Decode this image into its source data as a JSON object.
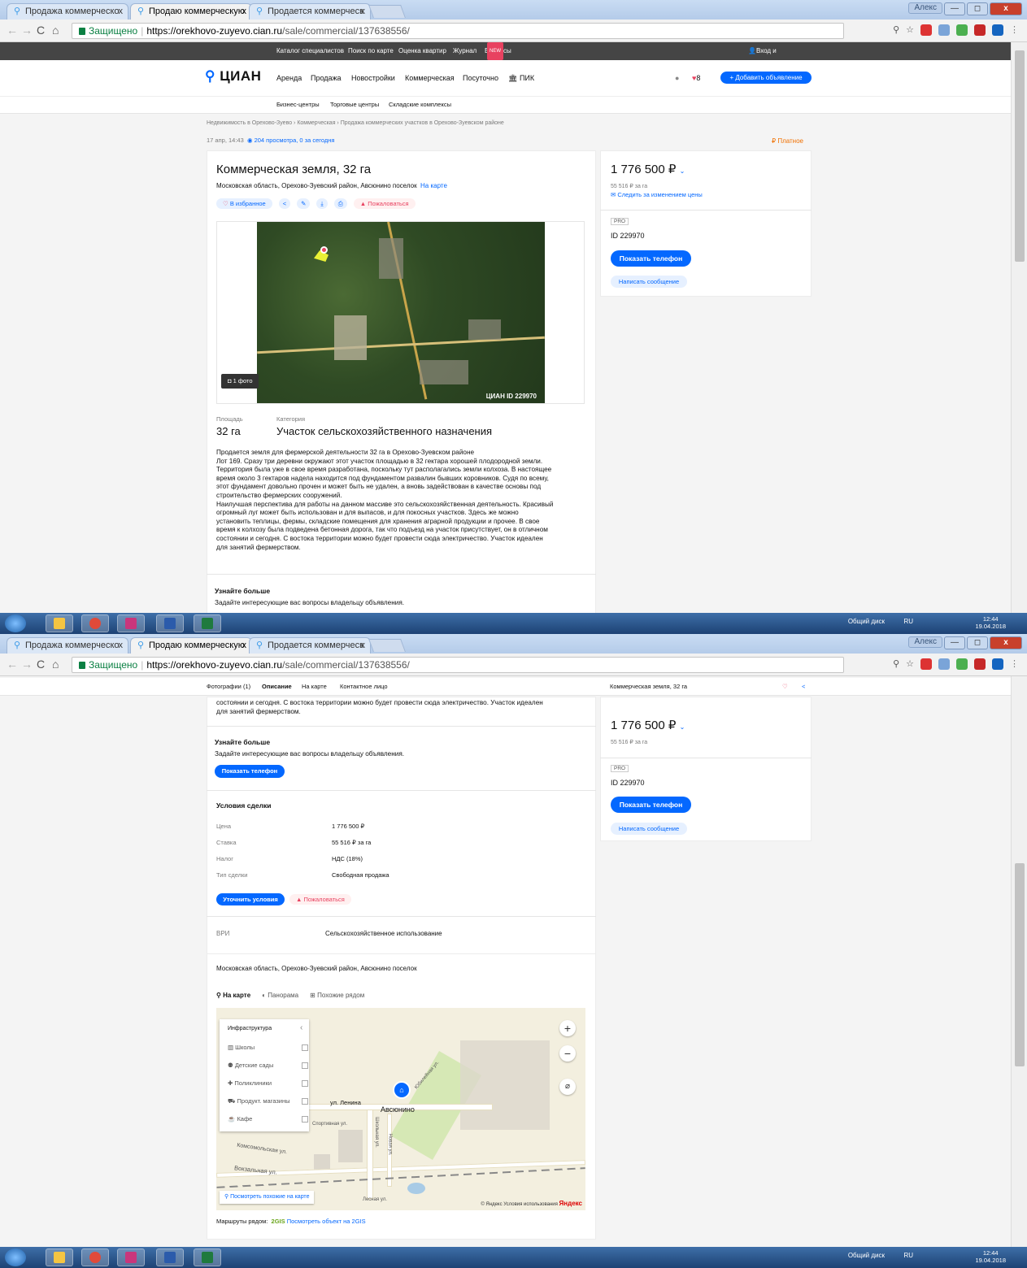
{
  "browser": {
    "tabs": [
      "Продажа коммерческо",
      "Продаю коммерческую",
      "Продается коммерческ"
    ],
    "tab_close": "x",
    "window_user": "Алекс",
    "window_buttons": [
      "—",
      "◻",
      "x"
    ],
    "nav_icons": [
      "←",
      "→",
      "C",
      "⌂"
    ],
    "secure_label": "Защищено",
    "url_host": "https://orekhovo-zuyevo.cian.ru",
    "url_path": "/sale/commercial/137638556/"
  },
  "topbar": {
    "links": [
      "Каталог специалистов",
      "Поиск по карте",
      "Оценка квартир",
      "Журнал",
      "Вопросы риэлтору"
    ],
    "new_badge": "NEW",
    "login": "Вход и регистрация"
  },
  "header": {
    "logo": "ЦИАН",
    "nav": [
      "Аренда",
      "Продажа",
      "Новостройки",
      "Коммерческая",
      "Посуточно",
      "ПИК"
    ],
    "favorites_count": "8",
    "add_button": "+ Добавить объявление",
    "subnav": [
      "Бизнес-центры",
      "Торговые центры",
      "Складские комплексы"
    ]
  },
  "breadcrumbs": "Недвижимость в Орехово-Зуево  ›  Коммерческая  ›  Продажа коммерческих участков в Орехово-Зуевском районе",
  "meta": {
    "date": "17 апр, 14:43",
    "views": "204 просмотра, 0 за сегодня",
    "paid": "Платное"
  },
  "listing": {
    "title": "Коммерческая земля, 32 га",
    "address": "Московская область, Орехово-Зуевский район, Авсюнино поселок",
    "on_map": "На карте",
    "favorite": "В избранное",
    "complain": "Пожаловаться",
    "photo_count": "1 фото",
    "watermark": "ЦИАН   ID 229970",
    "area_label": "Площадь",
    "area_value": "32 га",
    "category_label": "Категория",
    "category_value": "Участок сельскохозяйственного назначения",
    "description": [
      "Продается земля для фермерской деятельности 32 га в Орехово-Зуевском районе",
      "Лот 169. Сразу три деревни окружают этот участок площадью в 32 гектара хорошей плодородной земли.",
      "Территория была уже в свое время разработана, поскольку тут располагались земли колхоза. В настоящее",
      "время около 3 гектаров надела находится под фундаментом развалин бывших коровников. Судя по всему,",
      "этот фундамент довольно прочен и может быть не удален, а вновь задействован в качестве основы под",
      "строительство фермерских сооружений.",
      "Наилучшая перспектива для работы на данном массиве это сельскохозяйственная деятельность. Красивый",
      "огромный луг может быть использован и для выпасов, и для покосных участков. Здесь же можно",
      "установить теплицы, фермы, складские помещения для хранения аграрной продукции и прочее. В свое",
      "время к колхозу была подведена бетонная дорога, так что подъезд на участок присутствует, он в отличном",
      "состоянии и сегодня. С востока территории можно будет провести сюда электричество. Участок идеален",
      "для занятий фермерством."
    ],
    "learn_more_title": "Узнайте больше",
    "learn_more_text": "Задайте интересующие вас вопросы владельцу объявления."
  },
  "price_card": {
    "price": "1 776 500 ₽",
    "per_unit": "55 516 ₽ за га",
    "follow": "Следить за изменением цены",
    "pro": "PRO",
    "id": "ID 229970",
    "show_phone": "Показать телефон",
    "write": "Написать сообщение"
  },
  "sticky": {
    "tabs": [
      "Фотографии (1)",
      "Описание",
      "На карте",
      "Контактное лицо"
    ],
    "title": "Коммерческая земля, 32 га",
    "desc_tail": [
      "состоянии и сегодня. С востока территории можно будет провести сюда электричество. Участок идеален",
      "для занятий фермерством."
    ]
  },
  "deal": {
    "title": "Условия сделки",
    "rows": [
      [
        "Цена",
        "1 776 500 ₽"
      ],
      [
        "Ставка",
        "55 516 ₽ за га"
      ],
      [
        "Налог",
        "НДС (18%)"
      ],
      [
        "Тип сделки",
        "Свободная продажа"
      ]
    ],
    "clarify": "Уточнить условия",
    "complain": "Пожаловаться",
    "vri_label": "ВРИ",
    "vri_value": "Сельскохозяйственное использование"
  },
  "map_block": {
    "address": "Московская область, Орехово-Зуевский район, Авсюнино поселок",
    "tabs": [
      "На карте",
      "Панорама",
      "Похожие рядом"
    ],
    "infra_title": "Инфраструктура",
    "infra": [
      "Школы",
      "Детские сады",
      "Поликлиники",
      "Продукт. магазины",
      "Кафе"
    ],
    "labels": [
      "ул. Ленина",
      "Авсюнино",
      "Комсомольская ул.",
      "Вокзальная ул.",
      "Спортивная ул.",
      "Школьная ул.",
      "Новая ул.",
      "Лесная ул.",
      "Юбилейная ул."
    ],
    "similar": "Посмотреть похожие на карте",
    "copyright": "© Яндекс Условия использования",
    "yandex": "Яндекс",
    "routes_label": "Маршруты рядом:",
    "gis": "2GIS",
    "gis_link": "Посмотреть объект на 2GIS"
  },
  "taskbar": {
    "drive": "Общий диск",
    "lang": "RU",
    "time": "12:44",
    "date": "19.04.2018"
  }
}
